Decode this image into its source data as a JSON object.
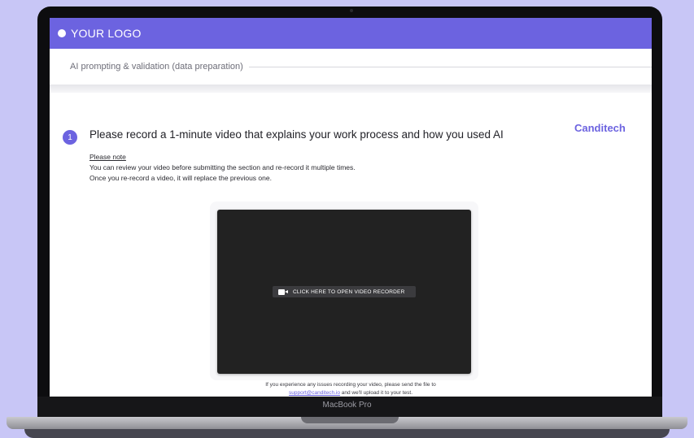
{
  "header": {
    "logo_text": "YOUR LOGO"
  },
  "section": {
    "title": "AI prompting & validation (data preparation)"
  },
  "brand": {
    "name": "Canditech",
    "accent_color": "#6c63e0"
  },
  "question": {
    "number": "1",
    "text": "Please record a 1-minute video that explains your work process and how you used AI"
  },
  "note": {
    "title": "Please note",
    "line1": "You can review your video before submitting the section and re-record it multiple times.",
    "line2": "Once you re-record a video, it will replace the previous one."
  },
  "video": {
    "button_label": "CLICK HERE TO OPEN VIDEO RECORDER",
    "icon": "video-camera-icon"
  },
  "help": {
    "line1": "If you experience any issues recording your video, please send the file to",
    "link_text": "support@canditech.io",
    "line2_rest": " and we'll upload it to your test."
  },
  "device": {
    "label": "MacBook Pro"
  }
}
